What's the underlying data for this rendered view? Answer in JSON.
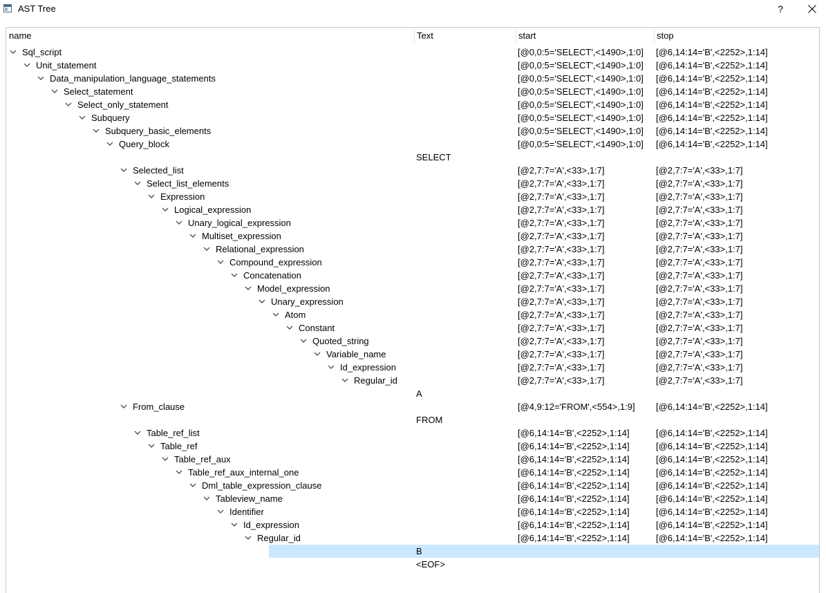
{
  "window": {
    "title": "AST Tree",
    "help_label": "?",
    "app_icon": "window-app-icon",
    "close_icon": "close-icon"
  },
  "tree": {
    "columns": [
      "name",
      "Text",
      "start",
      "stop"
    ],
    "rows": [
      {
        "depth": 0,
        "name": "Sql_script",
        "text": "",
        "start": "[@0,0:5='SELECT',<1490>,1:0]",
        "stop": "[@6,14:14='B',<2252>,1:14]",
        "expanded": true
      },
      {
        "depth": 1,
        "name": "Unit_statement",
        "text": "",
        "start": "[@0,0:5='SELECT',<1490>,1:0]",
        "stop": "[@6,14:14='B',<2252>,1:14]",
        "expanded": true
      },
      {
        "depth": 2,
        "name": "Data_manipulation_language_statements",
        "text": "",
        "start": "[@0,0:5='SELECT',<1490>,1:0]",
        "stop": "[@6,14:14='B',<2252>,1:14]",
        "expanded": true
      },
      {
        "depth": 3,
        "name": "Select_statement",
        "text": "",
        "start": "[@0,0:5='SELECT',<1490>,1:0]",
        "stop": "[@6,14:14='B',<2252>,1:14]",
        "expanded": true
      },
      {
        "depth": 4,
        "name": "Select_only_statement",
        "text": "",
        "start": "[@0,0:5='SELECT',<1490>,1:0]",
        "stop": "[@6,14:14='B',<2252>,1:14]",
        "expanded": true
      },
      {
        "depth": 5,
        "name": "Subquery",
        "text": "",
        "start": "[@0,0:5='SELECT',<1490>,1:0]",
        "stop": "[@6,14:14='B',<2252>,1:14]",
        "expanded": true
      },
      {
        "depth": 6,
        "name": "Subquery_basic_elements",
        "text": "",
        "start": "[@0,0:5='SELECT',<1490>,1:0]",
        "stop": "[@6,14:14='B',<2252>,1:14]",
        "expanded": true
      },
      {
        "depth": 7,
        "name": "Query_block",
        "text": "",
        "start": "[@0,0:5='SELECT',<1490>,1:0]",
        "stop": "[@6,14:14='B',<2252>,1:14]",
        "expanded": true
      },
      {
        "depth": 8,
        "name": "",
        "text": "SELECT",
        "start": "",
        "stop": "",
        "expanded": false
      },
      {
        "depth": 8,
        "name": "Selected_list",
        "text": "",
        "start": "[@2,7:7='A',<33>,1:7]",
        "stop": "[@2,7:7='A',<33>,1:7]",
        "expanded": true
      },
      {
        "depth": 9,
        "name": "Select_list_elements",
        "text": "",
        "start": "[@2,7:7='A',<33>,1:7]",
        "stop": "[@2,7:7='A',<33>,1:7]",
        "expanded": true
      },
      {
        "depth": 10,
        "name": "Expression",
        "text": "",
        "start": "[@2,7:7='A',<33>,1:7]",
        "stop": "[@2,7:7='A',<33>,1:7]",
        "expanded": true
      },
      {
        "depth": 11,
        "name": "Logical_expression",
        "text": "",
        "start": "[@2,7:7='A',<33>,1:7]",
        "stop": "[@2,7:7='A',<33>,1:7]",
        "expanded": true
      },
      {
        "depth": 12,
        "name": "Unary_logical_expression",
        "text": "",
        "start": "[@2,7:7='A',<33>,1:7]",
        "stop": "[@2,7:7='A',<33>,1:7]",
        "expanded": true
      },
      {
        "depth": 13,
        "name": "Multiset_expression",
        "text": "",
        "start": "[@2,7:7='A',<33>,1:7]",
        "stop": "[@2,7:7='A',<33>,1:7]",
        "expanded": true
      },
      {
        "depth": 14,
        "name": "Relational_expression",
        "text": "",
        "start": "[@2,7:7='A',<33>,1:7]",
        "stop": "[@2,7:7='A',<33>,1:7]",
        "expanded": true
      },
      {
        "depth": 15,
        "name": "Compound_expression",
        "text": "",
        "start": "[@2,7:7='A',<33>,1:7]",
        "stop": "[@2,7:7='A',<33>,1:7]",
        "expanded": true
      },
      {
        "depth": 16,
        "name": "Concatenation",
        "text": "",
        "start": "[@2,7:7='A',<33>,1:7]",
        "stop": "[@2,7:7='A',<33>,1:7]",
        "expanded": true
      },
      {
        "depth": 17,
        "name": "Model_expression",
        "text": "",
        "start": "[@2,7:7='A',<33>,1:7]",
        "stop": "[@2,7:7='A',<33>,1:7]",
        "expanded": true
      },
      {
        "depth": 18,
        "name": "Unary_expression",
        "text": "",
        "start": "[@2,7:7='A',<33>,1:7]",
        "stop": "[@2,7:7='A',<33>,1:7]",
        "expanded": true
      },
      {
        "depth": 19,
        "name": "Atom",
        "text": "",
        "start": "[@2,7:7='A',<33>,1:7]",
        "stop": "[@2,7:7='A',<33>,1:7]",
        "expanded": true
      },
      {
        "depth": 20,
        "name": "Constant",
        "text": "",
        "start": "[@2,7:7='A',<33>,1:7]",
        "stop": "[@2,7:7='A',<33>,1:7]",
        "expanded": true
      },
      {
        "depth": 21,
        "name": "Quoted_string",
        "text": "",
        "start": "[@2,7:7='A',<33>,1:7]",
        "stop": "[@2,7:7='A',<33>,1:7]",
        "expanded": true
      },
      {
        "depth": 22,
        "name": "Variable_name",
        "text": "",
        "start": "[@2,7:7='A',<33>,1:7]",
        "stop": "[@2,7:7='A',<33>,1:7]",
        "expanded": true
      },
      {
        "depth": 23,
        "name": "Id_expression",
        "text": "",
        "start": "[@2,7:7='A',<33>,1:7]",
        "stop": "[@2,7:7='A',<33>,1:7]",
        "expanded": true
      },
      {
        "depth": 24,
        "name": "Regular_id",
        "text": "",
        "start": "[@2,7:7='A',<33>,1:7]",
        "stop": "[@2,7:7='A',<33>,1:7]",
        "expanded": true
      },
      {
        "depth": 25,
        "name": "",
        "text": "A",
        "start": "",
        "stop": "",
        "expanded": false
      },
      {
        "depth": 8,
        "name": "From_clause",
        "text": "",
        "start": "[@4,9:12='FROM',<554>,1:9]",
        "stop": "[@6,14:14='B',<2252>,1:14]",
        "expanded": true
      },
      {
        "depth": 9,
        "name": "",
        "text": "FROM",
        "start": "",
        "stop": "",
        "expanded": false
      },
      {
        "depth": 9,
        "name": "Table_ref_list",
        "text": "",
        "start": "[@6,14:14='B',<2252>,1:14]",
        "stop": "[@6,14:14='B',<2252>,1:14]",
        "expanded": true
      },
      {
        "depth": 10,
        "name": "Table_ref",
        "text": "",
        "start": "[@6,14:14='B',<2252>,1:14]",
        "stop": "[@6,14:14='B',<2252>,1:14]",
        "expanded": true
      },
      {
        "depth": 11,
        "name": "Table_ref_aux",
        "text": "",
        "start": "[@6,14:14='B',<2252>,1:14]",
        "stop": "[@6,14:14='B',<2252>,1:14]",
        "expanded": true
      },
      {
        "depth": 12,
        "name": "Table_ref_aux_internal_one",
        "text": "",
        "start": "[@6,14:14='B',<2252>,1:14]",
        "stop": "[@6,14:14='B',<2252>,1:14]",
        "expanded": true
      },
      {
        "depth": 13,
        "name": "Dml_table_expression_clause",
        "text": "",
        "start": "[@6,14:14='B',<2252>,1:14]",
        "stop": "[@6,14:14='B',<2252>,1:14]",
        "expanded": true
      },
      {
        "depth": 14,
        "name": "Tableview_name",
        "text": "",
        "start": "[@6,14:14='B',<2252>,1:14]",
        "stop": "[@6,14:14='B',<2252>,1:14]",
        "expanded": true
      },
      {
        "depth": 15,
        "name": "Identifier",
        "text": "",
        "start": "[@6,14:14='B',<2252>,1:14]",
        "stop": "[@6,14:14='B',<2252>,1:14]",
        "expanded": true
      },
      {
        "depth": 16,
        "name": "Id_expression",
        "text": "",
        "start": "[@6,14:14='B',<2252>,1:14]",
        "stop": "[@6,14:14='B',<2252>,1:14]",
        "expanded": true
      },
      {
        "depth": 17,
        "name": "Regular_id",
        "text": "",
        "start": "[@6,14:14='B',<2252>,1:14]",
        "stop": "[@6,14:14='B',<2252>,1:14]",
        "expanded": true
      },
      {
        "depth": 18,
        "name": "",
        "text": "B",
        "start": "",
        "stop": "",
        "expanded": false,
        "selected": true
      },
      {
        "depth": 8,
        "name": "",
        "text": "<EOF>",
        "start": "",
        "stop": "",
        "expanded": false
      }
    ]
  },
  "colors": {
    "selection": "#cce8ff",
    "border": "#c9c9c9"
  }
}
